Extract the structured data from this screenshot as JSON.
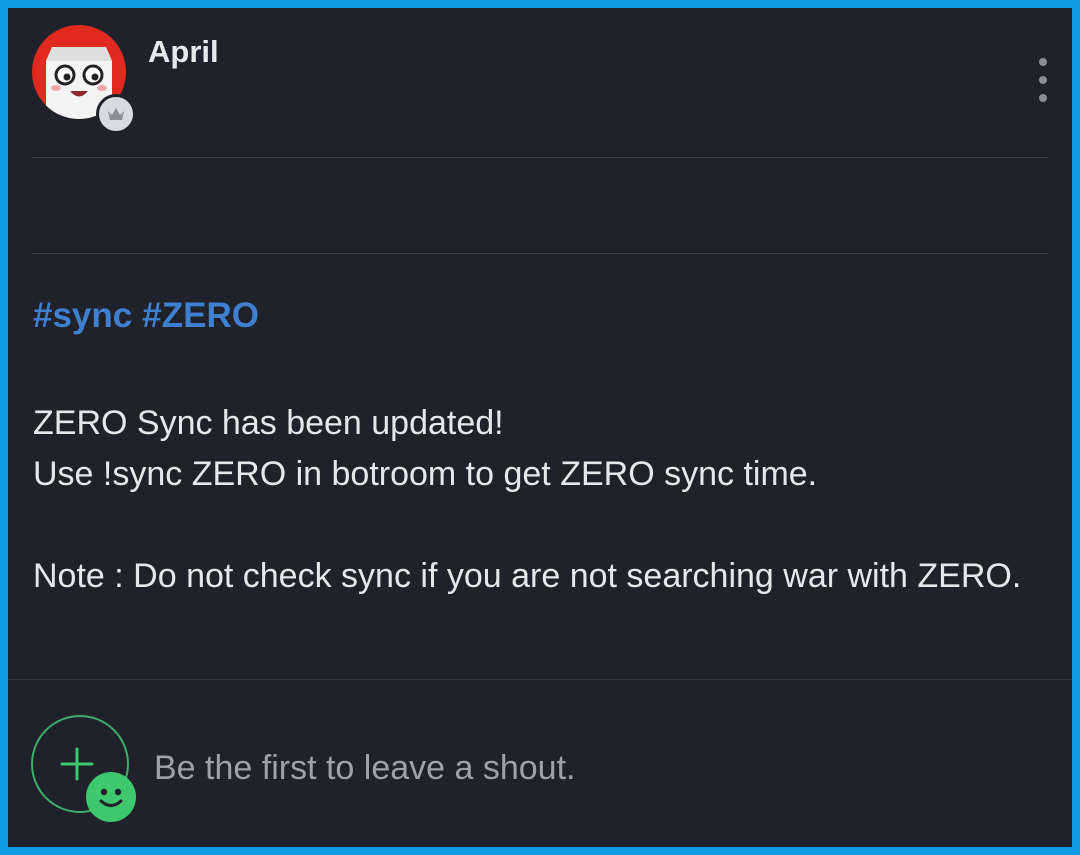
{
  "post": {
    "author": "April",
    "tags": [
      "#sync",
      "#ZERO"
    ],
    "body_lines": [
      "ZERO Sync has been updated!",
      "Use !sync ZERO in botroom to get ZERO sync time."
    ],
    "note": "Note : Do not check sync if you are not searching war with ZERO."
  },
  "comments": {
    "placeholder": "Be the first to leave a shout."
  },
  "icons": {
    "avatar": "milk-carton-face-avatar",
    "badge": "crown-icon",
    "more": "more-vertical-icon",
    "add_shout": "add-comment-icon",
    "smiley": "smiley-icon"
  },
  "colors": {
    "frame": "#0f9ee0",
    "background": "#1f222b",
    "hashtag": "#3f7fd0",
    "text": "#e6e7ea",
    "muted": "#9ea1a8",
    "accent_green": "#3fc76e",
    "avatar_red": "#e02a1f"
  }
}
